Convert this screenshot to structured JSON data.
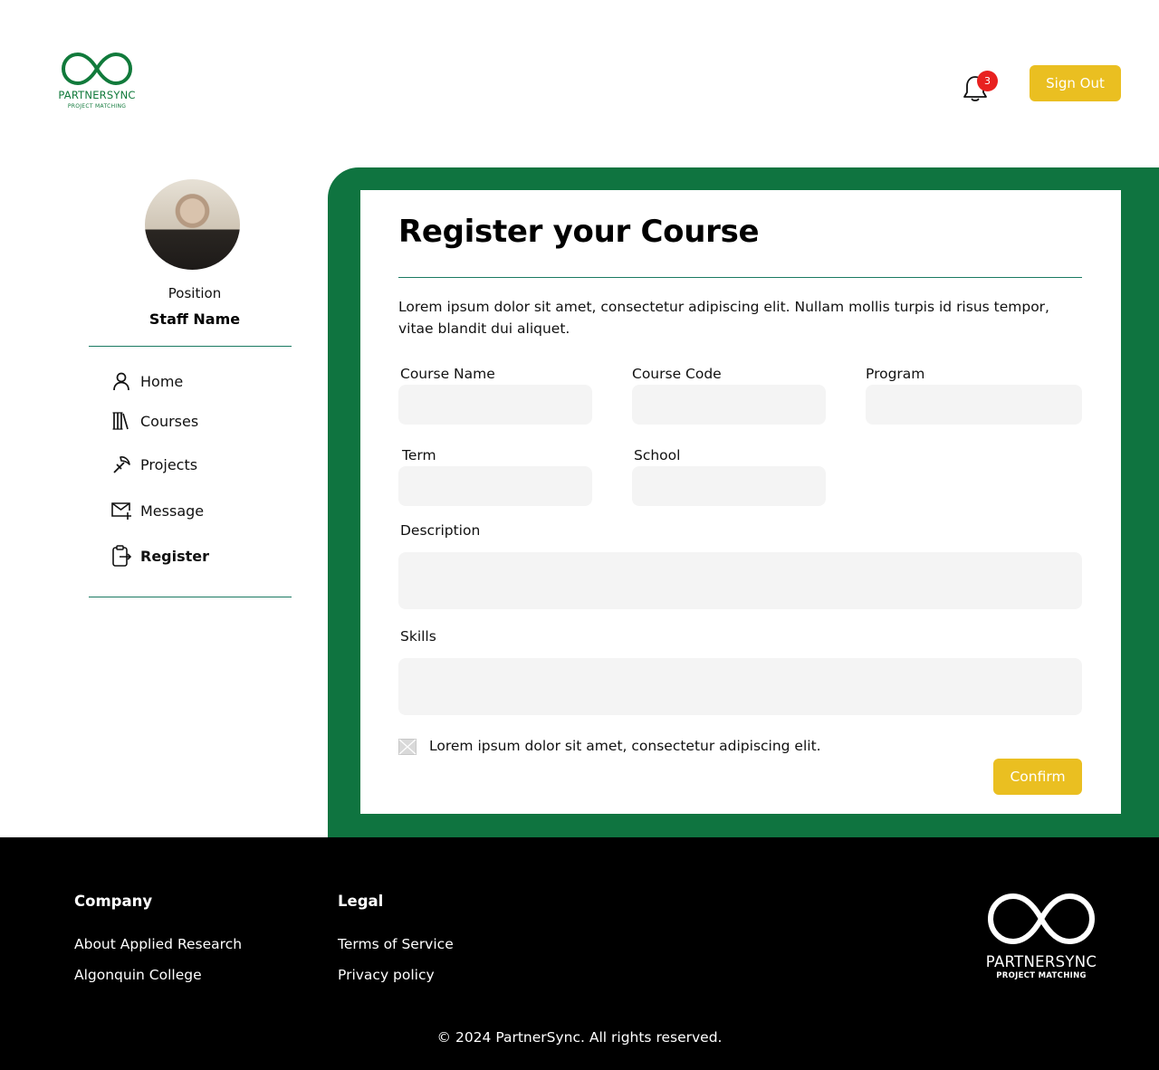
{
  "brand": {
    "name": "PARTNERSYNC",
    "tagline": "PROJECT MATCHING"
  },
  "header": {
    "notification_count": "3",
    "signout_label": "Sign Out"
  },
  "profile": {
    "position": "Position",
    "name": "Staff Name"
  },
  "nav": [
    {
      "label": "Home",
      "icon": "user-icon"
    },
    {
      "label": "Courses",
      "icon": "books-icon"
    },
    {
      "label": "Projects",
      "icon": "tools-icon"
    },
    {
      "label": "Message",
      "icon": "mail-plus-icon"
    },
    {
      "label": "Register",
      "icon": "clipboard-arrow-icon",
      "active": true
    }
  ],
  "form": {
    "title": "Register your Course",
    "intro": "Lorem ipsum dolor sit amet, consectetur adipiscing elit. Nullam mollis turpis id risus tempor, vitae blandit dui aliquet.",
    "fields": {
      "course_name": {
        "label": "Course Name",
        "value": ""
      },
      "course_code": {
        "label": "Course Code",
        "value": ""
      },
      "program": {
        "label": "Program",
        "value": ""
      },
      "term": {
        "label": "Term",
        "value": ""
      },
      "school": {
        "label": "School",
        "value": ""
      },
      "description": {
        "label": "Description",
        "value": ""
      },
      "skills": {
        "label": "Skills",
        "value": ""
      }
    },
    "checkbox_label": "Lorem ipsum dolor sit amet, consectetur adipiscing elit.",
    "confirm_label": "Confirm"
  },
  "footer": {
    "company_heading": "Company",
    "company_links": [
      "About Applied Research",
      "Algonquin College"
    ],
    "legal_heading": "Legal",
    "legal_links": [
      "Terms of Service",
      "Privacy policy"
    ],
    "copyright": "© 2024 PartnerSync. All rights reserved."
  },
  "colors": {
    "brand_green": "#0f7440",
    "accent_yellow": "#eabf21",
    "badge_red": "#e8211f"
  }
}
